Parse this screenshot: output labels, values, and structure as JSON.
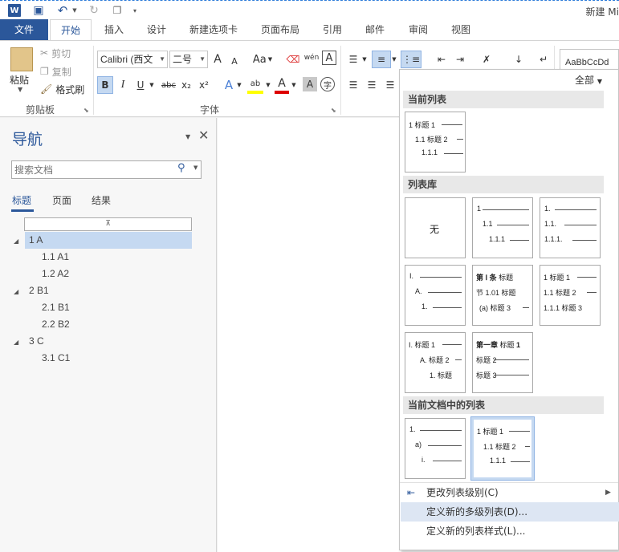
{
  "titlebar": {
    "doc_title": "新建 Mi"
  },
  "tabs": [
    "文件",
    "开始",
    "插入",
    "设计",
    "新建选项卡",
    "页面布局",
    "引用",
    "邮件",
    "审阅",
    "视图"
  ],
  "ribbon": {
    "clipboard": {
      "paste": "粘贴",
      "cut": "剪切",
      "copy": "复制",
      "format_painter": "格式刷",
      "group_label": "剪贴板"
    },
    "font": {
      "font_name": "Calibri (西文",
      "font_size": "二号",
      "grow": "A",
      "shrink": "A",
      "case": "Aa",
      "phonetic": "wén",
      "group_label": "字体",
      "bold": "B",
      "italic": "I",
      "underline": "U",
      "strike": "abc",
      "sub": "x₂",
      "sup": "x²"
    },
    "styles_preview": "AaBbCcDd"
  },
  "nav": {
    "title": "导航",
    "search_placeholder": "搜索文档",
    "tabs": [
      "标题",
      "页面",
      "结果"
    ],
    "tree": [
      {
        "label": "1 A",
        "level": 1,
        "selected": true,
        "expanded": true
      },
      {
        "label": "1.1 A1",
        "level": 2
      },
      {
        "label": "1.2 A2",
        "level": 2
      },
      {
        "label": "2 B1",
        "level": 1,
        "expanded": true
      },
      {
        "label": "2.1 B1",
        "level": 2
      },
      {
        "label": "2.2 B2",
        "level": 2
      },
      {
        "label": "3 C",
        "level": 1,
        "expanded": true
      },
      {
        "label": "3.1 C1",
        "level": 2
      }
    ]
  },
  "dropdown": {
    "filter": "全部",
    "sec_current": "当前列表",
    "sec_library": "列表库",
    "sec_doc": "当前文档中的列表",
    "none_label": "无",
    "thumb_heading": "标题",
    "menu": [
      {
        "label": "更改列表级别(C)",
        "has_arrow": true
      },
      {
        "label": "定义新的多级列表(D)...",
        "highlight": true
      },
      {
        "label": "定义新的列表样式(L)..."
      }
    ],
    "lib_chapter": {
      "l1": "第 Ⅰ 条",
      "l2": "节 1.01",
      "l3": "(a)"
    },
    "lib_chapter2": {
      "l1": "第一章"
    }
  }
}
